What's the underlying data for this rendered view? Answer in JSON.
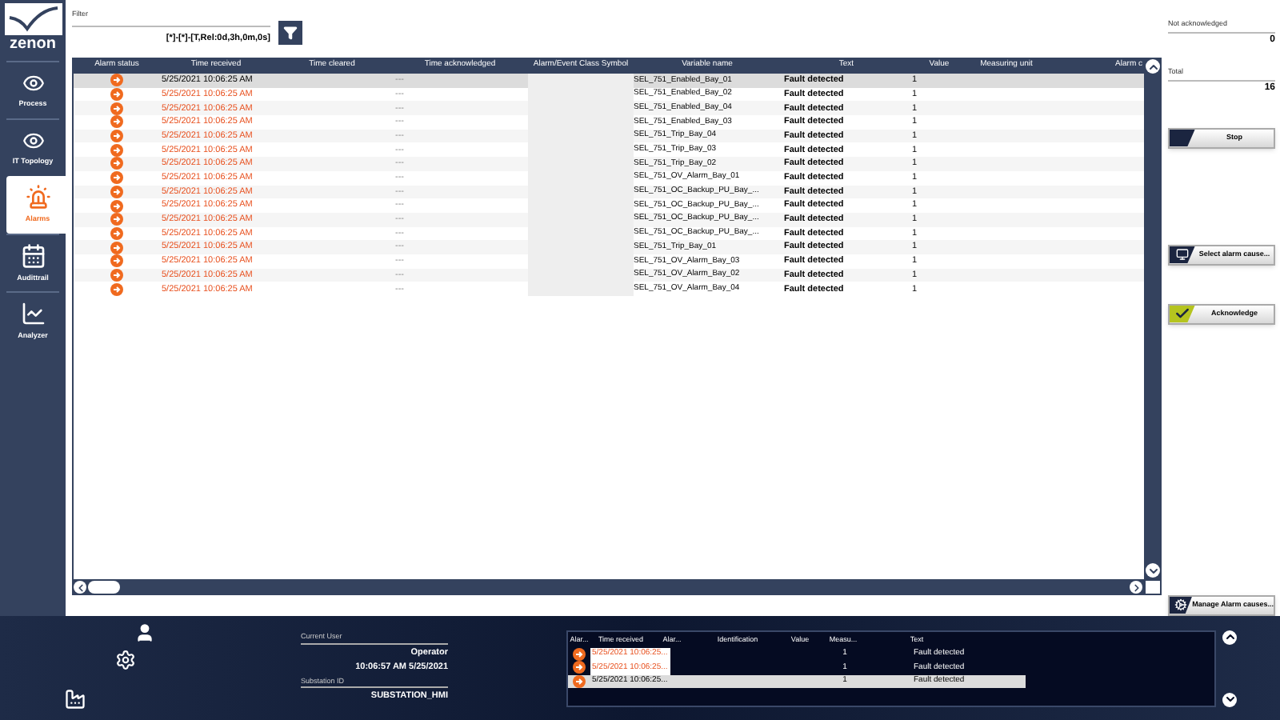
{
  "sidebar": {
    "logo": "zenon",
    "items": [
      {
        "label": "Process",
        "kind": "eye",
        "selected": false
      },
      {
        "label": "IT Topology",
        "kind": "eye",
        "selected": false
      },
      {
        "label": "Alarms",
        "kind": "siren",
        "selected": true
      },
      {
        "label": "Audittrail",
        "kind": "calendar",
        "selected": false
      },
      {
        "label": "Analyzer",
        "kind": "chart",
        "selected": false
      }
    ]
  },
  "filter": {
    "label": "Filter",
    "value": "[*]-[*]-[T,Rel:0d,3h,0m,0s]"
  },
  "table": {
    "columns": [
      "Alarm status",
      "Time received",
      "Time cleared",
      "Time acknowledged",
      "Alarm/Event Class Symbol",
      "Variable name",
      "Text",
      "Value",
      "Measuring unit",
      "Alarm c"
    ],
    "rows": [
      {
        "time_received": "5/25/2021 10:06:25 AM",
        "time_acknowledged": "---",
        "variable_name": "SEL_751_Enabled_Bay_01",
        "text": "Fault detected",
        "value": "1",
        "selected": true
      },
      {
        "time_received": "5/25/2021 10:06:25 AM",
        "time_acknowledged": "---",
        "variable_name": "SEL_751_Enabled_Bay_02",
        "text": "Fault detected",
        "value": "1",
        "selected": false
      },
      {
        "time_received": "5/25/2021 10:06:25 AM",
        "time_acknowledged": "---",
        "variable_name": "SEL_751_Enabled_Bay_04",
        "text": "Fault detected",
        "value": "1",
        "selected": false
      },
      {
        "time_received": "5/25/2021 10:06:25 AM",
        "time_acknowledged": "---",
        "variable_name": "SEL_751_Enabled_Bay_03",
        "text": "Fault detected",
        "value": "1",
        "selected": false
      },
      {
        "time_received": "5/25/2021 10:06:25 AM",
        "time_acknowledged": "---",
        "variable_name": "SEL_751_Trip_Bay_04",
        "text": "Fault detected",
        "value": "1",
        "selected": false
      },
      {
        "time_received": "5/25/2021 10:06:25 AM",
        "time_acknowledged": "---",
        "variable_name": "SEL_751_Trip_Bay_03",
        "text": "Fault detected",
        "value": "1",
        "selected": false
      },
      {
        "time_received": "5/25/2021 10:06:25 AM",
        "time_acknowledged": "---",
        "variable_name": "SEL_751_Trip_Bay_02",
        "text": "Fault detected",
        "value": "1",
        "selected": false
      },
      {
        "time_received": "5/25/2021 10:06:25 AM",
        "time_acknowledged": "---",
        "variable_name": "SEL_751_OV_Alarm_Bay_01",
        "text": "Fault detected",
        "value": "1",
        "selected": false
      },
      {
        "time_received": "5/25/2021 10:06:25 AM",
        "time_acknowledged": "---",
        "variable_name": "SEL_751_OC_Backup_PU_Bay_...",
        "text": "Fault detected",
        "value": "1",
        "selected": false
      },
      {
        "time_received": "5/25/2021 10:06:25 AM",
        "time_acknowledged": "---",
        "variable_name": "SEL_751_OC_Backup_PU_Bay_...",
        "text": "Fault detected",
        "value": "1",
        "selected": false
      },
      {
        "time_received": "5/25/2021 10:06:25 AM",
        "time_acknowledged": "---",
        "variable_name": "SEL_751_OC_Backup_PU_Bay_...",
        "text": "Fault detected",
        "value": "1",
        "selected": false
      },
      {
        "time_received": "5/25/2021 10:06:25 AM",
        "time_acknowledged": "---",
        "variable_name": "SEL_751_OC_Backup_PU_Bay_...",
        "text": "Fault detected",
        "value": "1",
        "selected": false
      },
      {
        "time_received": "5/25/2021 10:06:25 AM",
        "time_acknowledged": "---",
        "variable_name": "SEL_751_Trip_Bay_01",
        "text": "Fault detected",
        "value": "1",
        "selected": false
      },
      {
        "time_received": "5/25/2021 10:06:25 AM",
        "time_acknowledged": "---",
        "variable_name": "SEL_751_OV_Alarm_Bay_03",
        "text": "Fault detected",
        "value": "1",
        "selected": false
      },
      {
        "time_received": "5/25/2021 10:06:25 AM",
        "time_acknowledged": "---",
        "variable_name": "SEL_751_OV_Alarm_Bay_02",
        "text": "Fault detected",
        "value": "1",
        "selected": false
      },
      {
        "time_received": "5/25/2021 10:06:25 AM",
        "time_acknowledged": "---",
        "variable_name": "SEL_751_OV_Alarm_Bay_04",
        "text": "Fault detected",
        "value": "1",
        "selected": false
      }
    ]
  },
  "counters": [
    {
      "label": "Not acknowledged",
      "value": "0"
    },
    {
      "label": "Total",
      "value": "16"
    }
  ],
  "buttons": [
    {
      "label": "Stop",
      "kind": "stop"
    },
    {
      "label": "Select alarm cause...",
      "kind": "cause"
    },
    {
      "label": "Acknowledge",
      "kind": "acknowledge"
    },
    {
      "label": "Manage Alarm causes...",
      "kind": "manage"
    }
  ],
  "user_panel": {
    "user_label": "Current User",
    "user": "Operator",
    "datetime": "10:06:57 AM 5/25/2021",
    "station_label": "Substation ID",
    "station": "SUBSTATION_HMI"
  },
  "mini_list": {
    "columns": [
      "Alar...",
      "Time received",
      "Alar...",
      "Identification",
      "Value",
      "Measu...",
      "Text"
    ],
    "rows": [
      {
        "time_received": "5/25/2021 10:06:25...",
        "value": "1",
        "text": "Fault detected",
        "selected": false
      },
      {
        "time_received": "5/25/2021 10:06:25...",
        "value": "1",
        "text": "Fault detected",
        "selected": false
      },
      {
        "time_received": "5/25/2021 10:06:25...",
        "value": "1",
        "text": "Fault detected",
        "selected": true
      }
    ]
  }
}
